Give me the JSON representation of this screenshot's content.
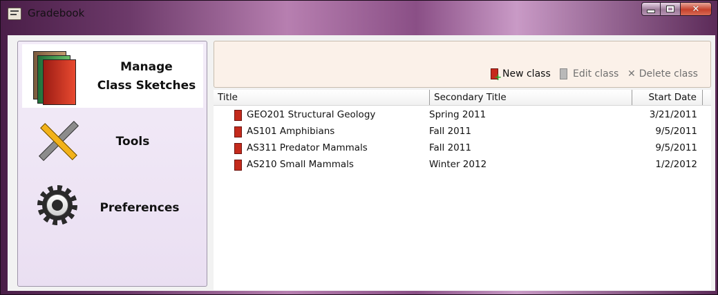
{
  "window": {
    "title": "Gradebook",
    "icon": "gradebook-app-icon",
    "controls": [
      "minimize",
      "maximize",
      "close"
    ]
  },
  "sidebar": {
    "items": [
      {
        "label": "Manage\nClass Sketches",
        "line1": "Manage",
        "line2": "Class Sketches",
        "icon": "books-icon",
        "selected": true
      },
      {
        "label": "Tools",
        "icon": "tools-icon",
        "selected": false
      },
      {
        "label": "Preferences",
        "icon": "gear-icon",
        "selected": false
      }
    ]
  },
  "toolbar": {
    "new_label": "New class",
    "edit_label": "Edit class",
    "delete_label": "Delete class"
  },
  "table": {
    "columns": [
      "Title",
      "Secondary Title",
      "Start Date"
    ],
    "rows": [
      {
        "title": "GEO201 Structural Geology",
        "secondary": "Spring 2011",
        "start_date": "3/21/2011"
      },
      {
        "title": "AS101 Amphibians",
        "secondary": "Fall 2011",
        "start_date": "9/5/2011"
      },
      {
        "title": "AS311 Predator Mammals",
        "secondary": "Fall 2011",
        "start_date": "9/5/2011"
      },
      {
        "title": "AS210 Small Mammals",
        "secondary": "Winter 2012",
        "start_date": "1/2/2012"
      }
    ]
  },
  "colors": {
    "accent_red": "#c42a1c",
    "sidebar_bg": "#eadff2",
    "toolbar_bg": "#fbf1e9"
  }
}
